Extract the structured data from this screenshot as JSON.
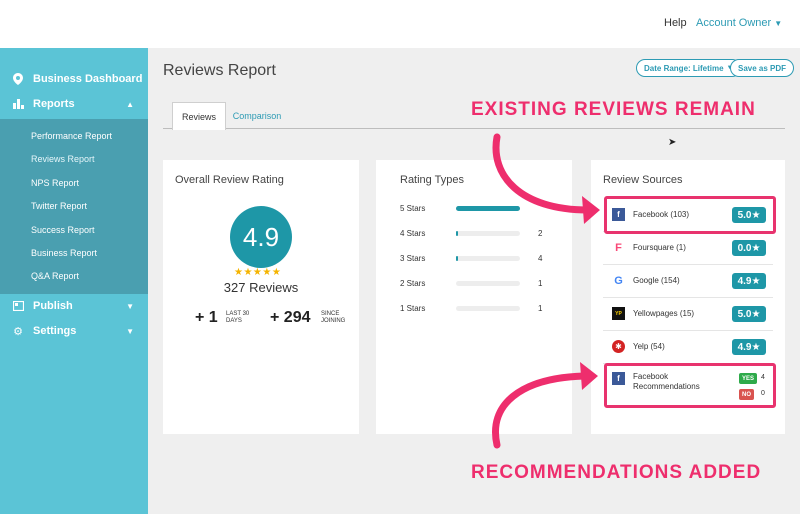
{
  "topbar": {
    "help": "Help",
    "account": "Account Owner"
  },
  "sidebar": {
    "main_items": [
      {
        "label": "Business Dashboard",
        "icon": "map-marker-icon"
      },
      {
        "label": "Reports",
        "icon": "bar-chart-icon",
        "expanded": true
      },
      {
        "label": "Publish",
        "icon": "publish-icon"
      },
      {
        "label": "Settings",
        "icon": "gear-icon"
      }
    ],
    "report_items": [
      {
        "label": "Performance Report"
      },
      {
        "label": "Reviews Report",
        "active": true
      },
      {
        "label": "NPS Report"
      },
      {
        "label": "Twitter Report"
      },
      {
        "label": "Success Report"
      },
      {
        "label": "Business Report"
      },
      {
        "label": "Q&A Report"
      }
    ]
  },
  "page": {
    "title": "Reviews Report",
    "date_range": "Date Range: Lifetime",
    "save_pdf": "Save as PDF",
    "tabs": [
      {
        "label": "Reviews",
        "active": true
      },
      {
        "label": "Comparison"
      }
    ]
  },
  "overall": {
    "title": "Overall Review Rating",
    "rating": "4.9",
    "stars": "★★★★★",
    "total": "327 Reviews",
    "stat1_value": "+ 1",
    "stat1_label_a": "LAST 30",
    "stat1_label_b": "DAYS",
    "stat2_value": "+ 294",
    "stat2_label_a": "SINCE",
    "stat2_label_b": "JOINING"
  },
  "rating_types": {
    "title": "Rating Types",
    "rows": [
      {
        "label": "5 Stars",
        "count": "",
        "fill": 1.0
      },
      {
        "label": "4 Stars",
        "count": "2",
        "fill": 0.02
      },
      {
        "label": "3 Stars",
        "count": "4",
        "fill": 0.03
      },
      {
        "label": "2 Stars",
        "count": "1",
        "fill": 0.0
      },
      {
        "label": "1 Stars",
        "count": "1",
        "fill": 0.0
      }
    ]
  },
  "sources": {
    "title": "Review Sources",
    "items": [
      {
        "name": "Facebook (103)",
        "score": "5.0★",
        "color": "#3b5998",
        "glyph": "f"
      },
      {
        "name": "Foursquare (1)",
        "score": "0.0★",
        "color": "#f94877",
        "glyph": "F"
      },
      {
        "name": "Google (154)",
        "score": "4.9★",
        "color": "#4285f4",
        "glyph": "G"
      },
      {
        "name": "Yellowpages (15)",
        "score": "5.0★",
        "color": "#111111",
        "glyph": "YP"
      },
      {
        "name": "Yelp (54)",
        "score": "4.9★",
        "color": "#d32323",
        "glyph": "✱"
      }
    ],
    "recommendations": {
      "name_a": "Facebook",
      "name_b": "Recommendations",
      "yes_label": "YES",
      "yes_count": "4",
      "no_label": "NO",
      "no_count": "0"
    }
  },
  "callouts": {
    "top": "EXISTING REVIEWS REMAIN",
    "bottom": "RECOMMENDATIONS ADDED"
  },
  "colors": {
    "accent": "#1e97a7",
    "sidebar": "#5bc4d6",
    "callout": "#ee2e6d"
  }
}
